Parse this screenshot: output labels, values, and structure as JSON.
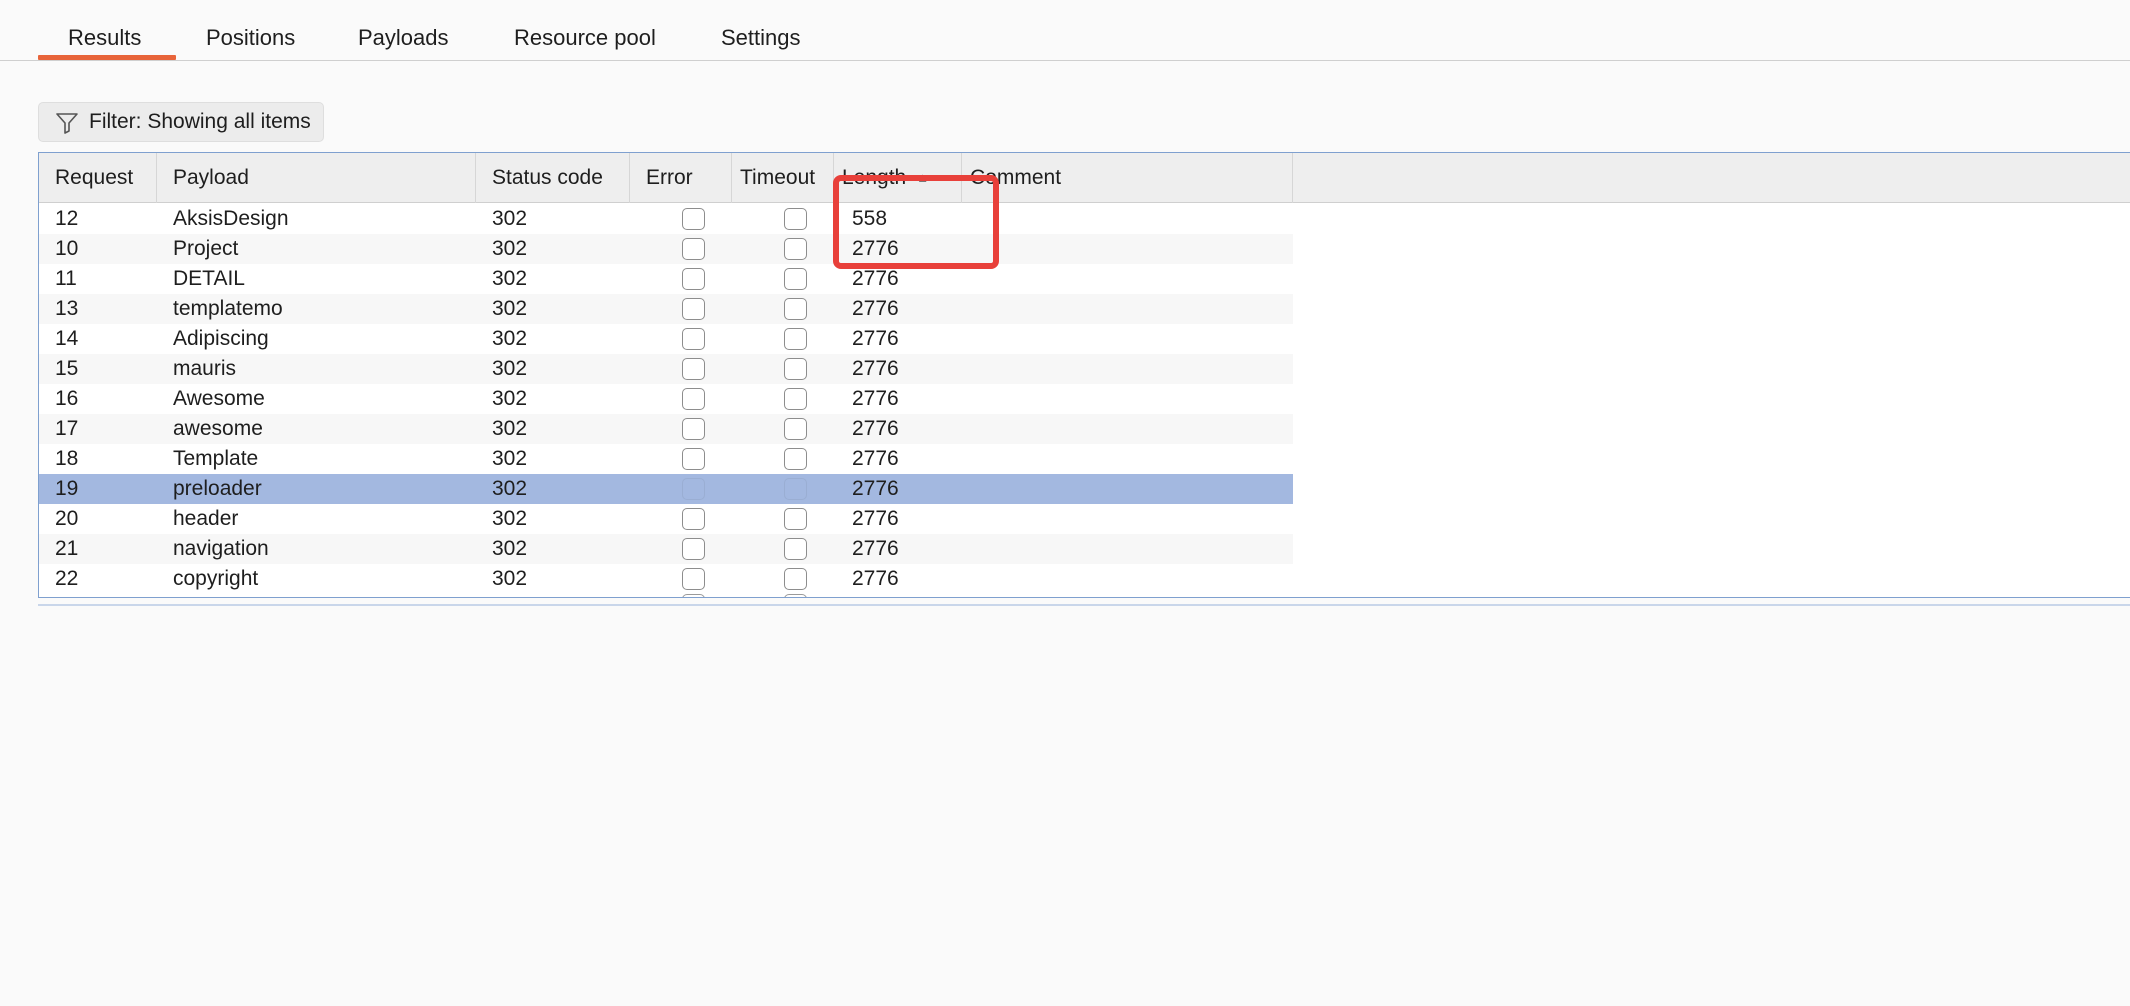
{
  "tabs": [
    {
      "label": "Results",
      "active": true
    },
    {
      "label": "Positions",
      "active": false
    },
    {
      "label": "Payloads",
      "active": false
    },
    {
      "label": "Resource pool",
      "active": false
    },
    {
      "label": "Settings",
      "active": false
    }
  ],
  "filter": {
    "label": "Filter: Showing all items",
    "icon": "filter-icon"
  },
  "table": {
    "columns": [
      "Request",
      "Payload",
      "Status code",
      "Error",
      "Timeout",
      "Length",
      "Comment"
    ],
    "sort": {
      "column": "Length",
      "direction": "ascending"
    },
    "rows": [
      {
        "request": "12",
        "payload": "AksisDesign",
        "status": "302",
        "error": false,
        "timeout": false,
        "length": "558",
        "comment": "",
        "selected": false
      },
      {
        "request": "10",
        "payload": "Project",
        "status": "302",
        "error": false,
        "timeout": false,
        "length": "2776",
        "comment": "",
        "selected": false
      },
      {
        "request": "11",
        "payload": "DETAIL",
        "status": "302",
        "error": false,
        "timeout": false,
        "length": "2776",
        "comment": "",
        "selected": false
      },
      {
        "request": "13",
        "payload": "templatemo",
        "status": "302",
        "error": false,
        "timeout": false,
        "length": "2776",
        "comment": "",
        "selected": false
      },
      {
        "request": "14",
        "payload": "Adipiscing",
        "status": "302",
        "error": false,
        "timeout": false,
        "length": "2776",
        "comment": "",
        "selected": false
      },
      {
        "request": "15",
        "payload": "mauris",
        "status": "302",
        "error": false,
        "timeout": false,
        "length": "2776",
        "comment": "",
        "selected": false
      },
      {
        "request": "16",
        "payload": "Awesome",
        "status": "302",
        "error": false,
        "timeout": false,
        "length": "2776",
        "comment": "",
        "selected": false
      },
      {
        "request": "17",
        "payload": "awesome",
        "status": "302",
        "error": false,
        "timeout": false,
        "length": "2776",
        "comment": "",
        "selected": false
      },
      {
        "request": "18",
        "payload": "Template",
        "status": "302",
        "error": false,
        "timeout": false,
        "length": "2776",
        "comment": "",
        "selected": false
      },
      {
        "request": "19",
        "payload": "preloader",
        "status": "302",
        "error": false,
        "timeout": false,
        "length": "2776",
        "comment": "",
        "selected": true
      },
      {
        "request": "20",
        "payload": "header",
        "status": "302",
        "error": false,
        "timeout": false,
        "length": "2776",
        "comment": "",
        "selected": false
      },
      {
        "request": "21",
        "payload": "navigation",
        "status": "302",
        "error": false,
        "timeout": false,
        "length": "2776",
        "comment": "",
        "selected": false
      },
      {
        "request": "22",
        "payload": "copyright",
        "status": "302",
        "error": false,
        "timeout": false,
        "length": "2776",
        "comment": "",
        "selected": false
      }
    ]
  },
  "annotation": {
    "color": "#e8403a"
  },
  "colors": {
    "accent": "#e8643a",
    "selection": "#a3b8e0",
    "table_border": "#7fa0cf"
  }
}
